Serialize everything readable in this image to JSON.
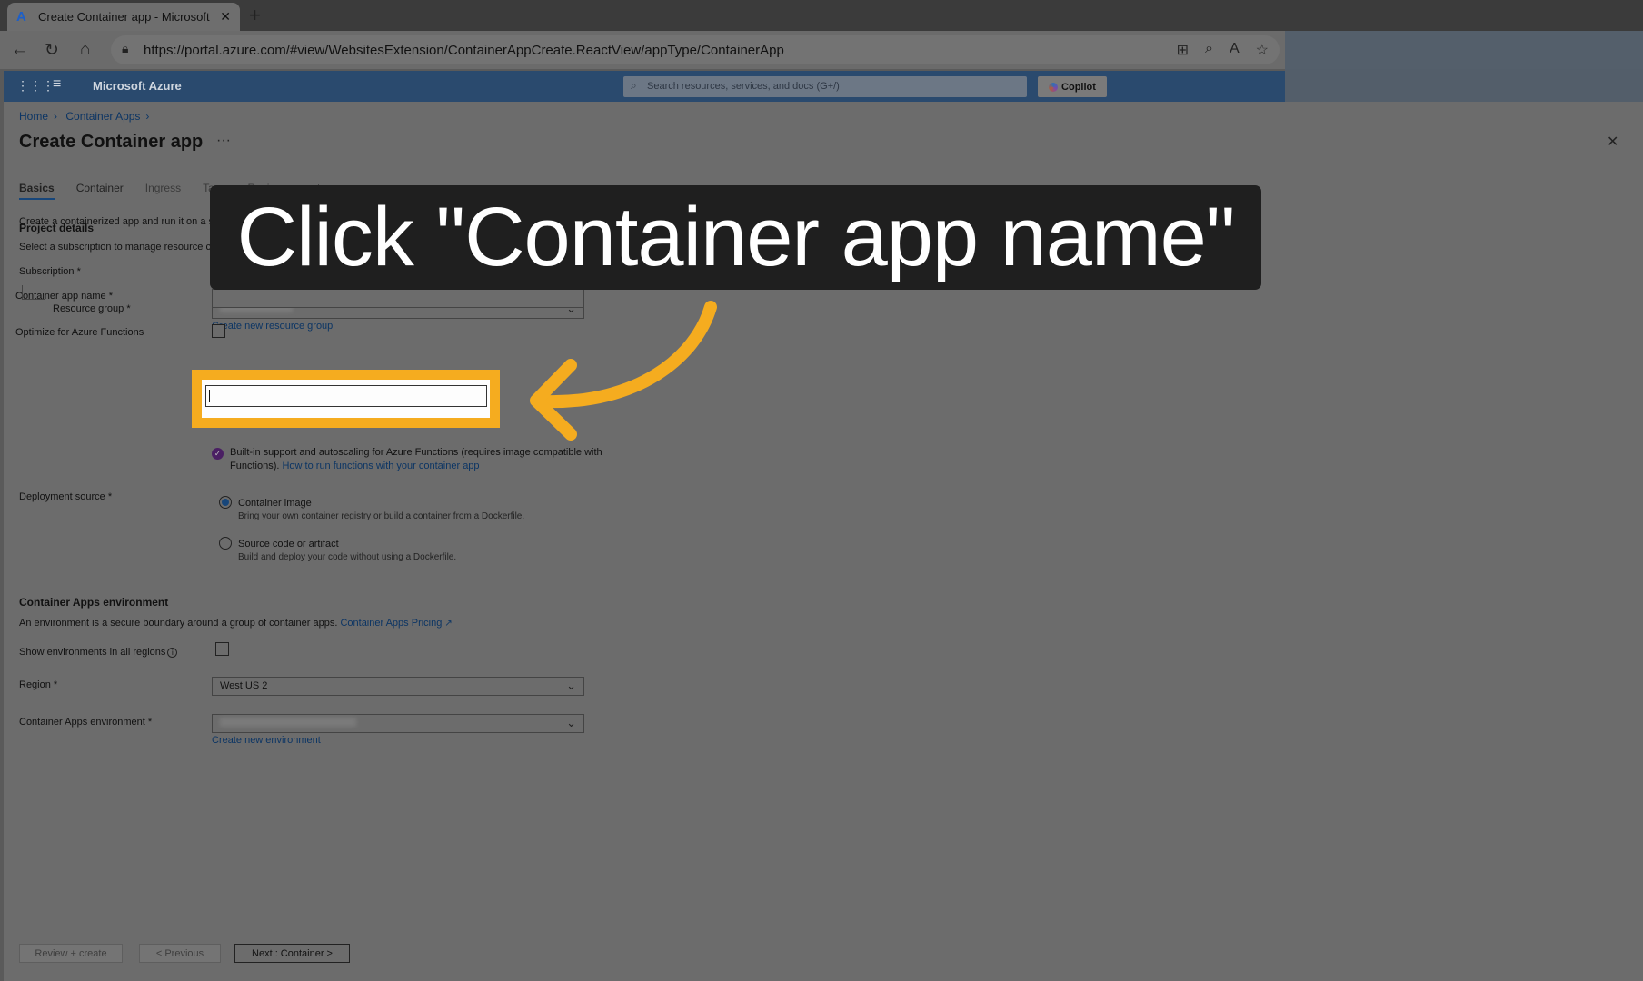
{
  "browser": {
    "tab_title": "Create Container app - Microsoft",
    "url": "https://portal.azure.com/#view/WebsitesExtension/ContainerAppCreate.ReactView/appType/ContainerApp"
  },
  "azure_bar": {
    "brand": "Microsoft Azure",
    "search_placeholder": "Search resources, services, and docs (G+/)",
    "copilot_label": "Copilot"
  },
  "breadcrumb": [
    "Home",
    "Container Apps"
  ],
  "page": {
    "title": "Create Container app",
    "more": "···"
  },
  "tabs": [
    "Basics",
    "Container",
    "Ingress",
    "Tags",
    "Review + create"
  ],
  "intro": "Create a containerized app and run it on a serverless platform.",
  "project_details": {
    "heading": "Project details",
    "description": "Select a subscription to manage resource creation and costs, and a resource group to organize all your resources for this deployment.",
    "subscription_label": "Subscription *",
    "resource_group_label": "Resource group *",
    "create_rg_link": "Create new resource group",
    "app_name_label": "Container app name *",
    "optimize_label": "Optimize for Azure Functions",
    "functions_info": "Built-in support and autoscaling for Azure Functions (requires image compatible with Functions).",
    "functions_link": "How to run functions with your container app",
    "deploy_source_label": "Deployment source *",
    "option1_title": "Container image",
    "option1_desc": "Bring your own container registry or build a container from a Dockerfile.",
    "option2_title": "Source code or artifact",
    "option2_desc": "Build and deploy your code without using a Dockerfile."
  },
  "environment": {
    "heading": "Container Apps environment",
    "description": "An environment is a secure boundary around a group of container apps.",
    "pricing_link": "Container Apps Pricing",
    "show_all_label": "Show environments in all regions",
    "region_label": "Region *",
    "region_value": "West US 2",
    "env_label": "Container Apps environment *",
    "create_env_link": "Create new environment"
  },
  "footer": {
    "review_label": "Review + create",
    "previous_label": "< Previous",
    "next_label": "Next : Container >"
  },
  "annotation": {
    "callout_text": "Click \"Container app name\"",
    "highlight_color": "#f5ac1f"
  }
}
